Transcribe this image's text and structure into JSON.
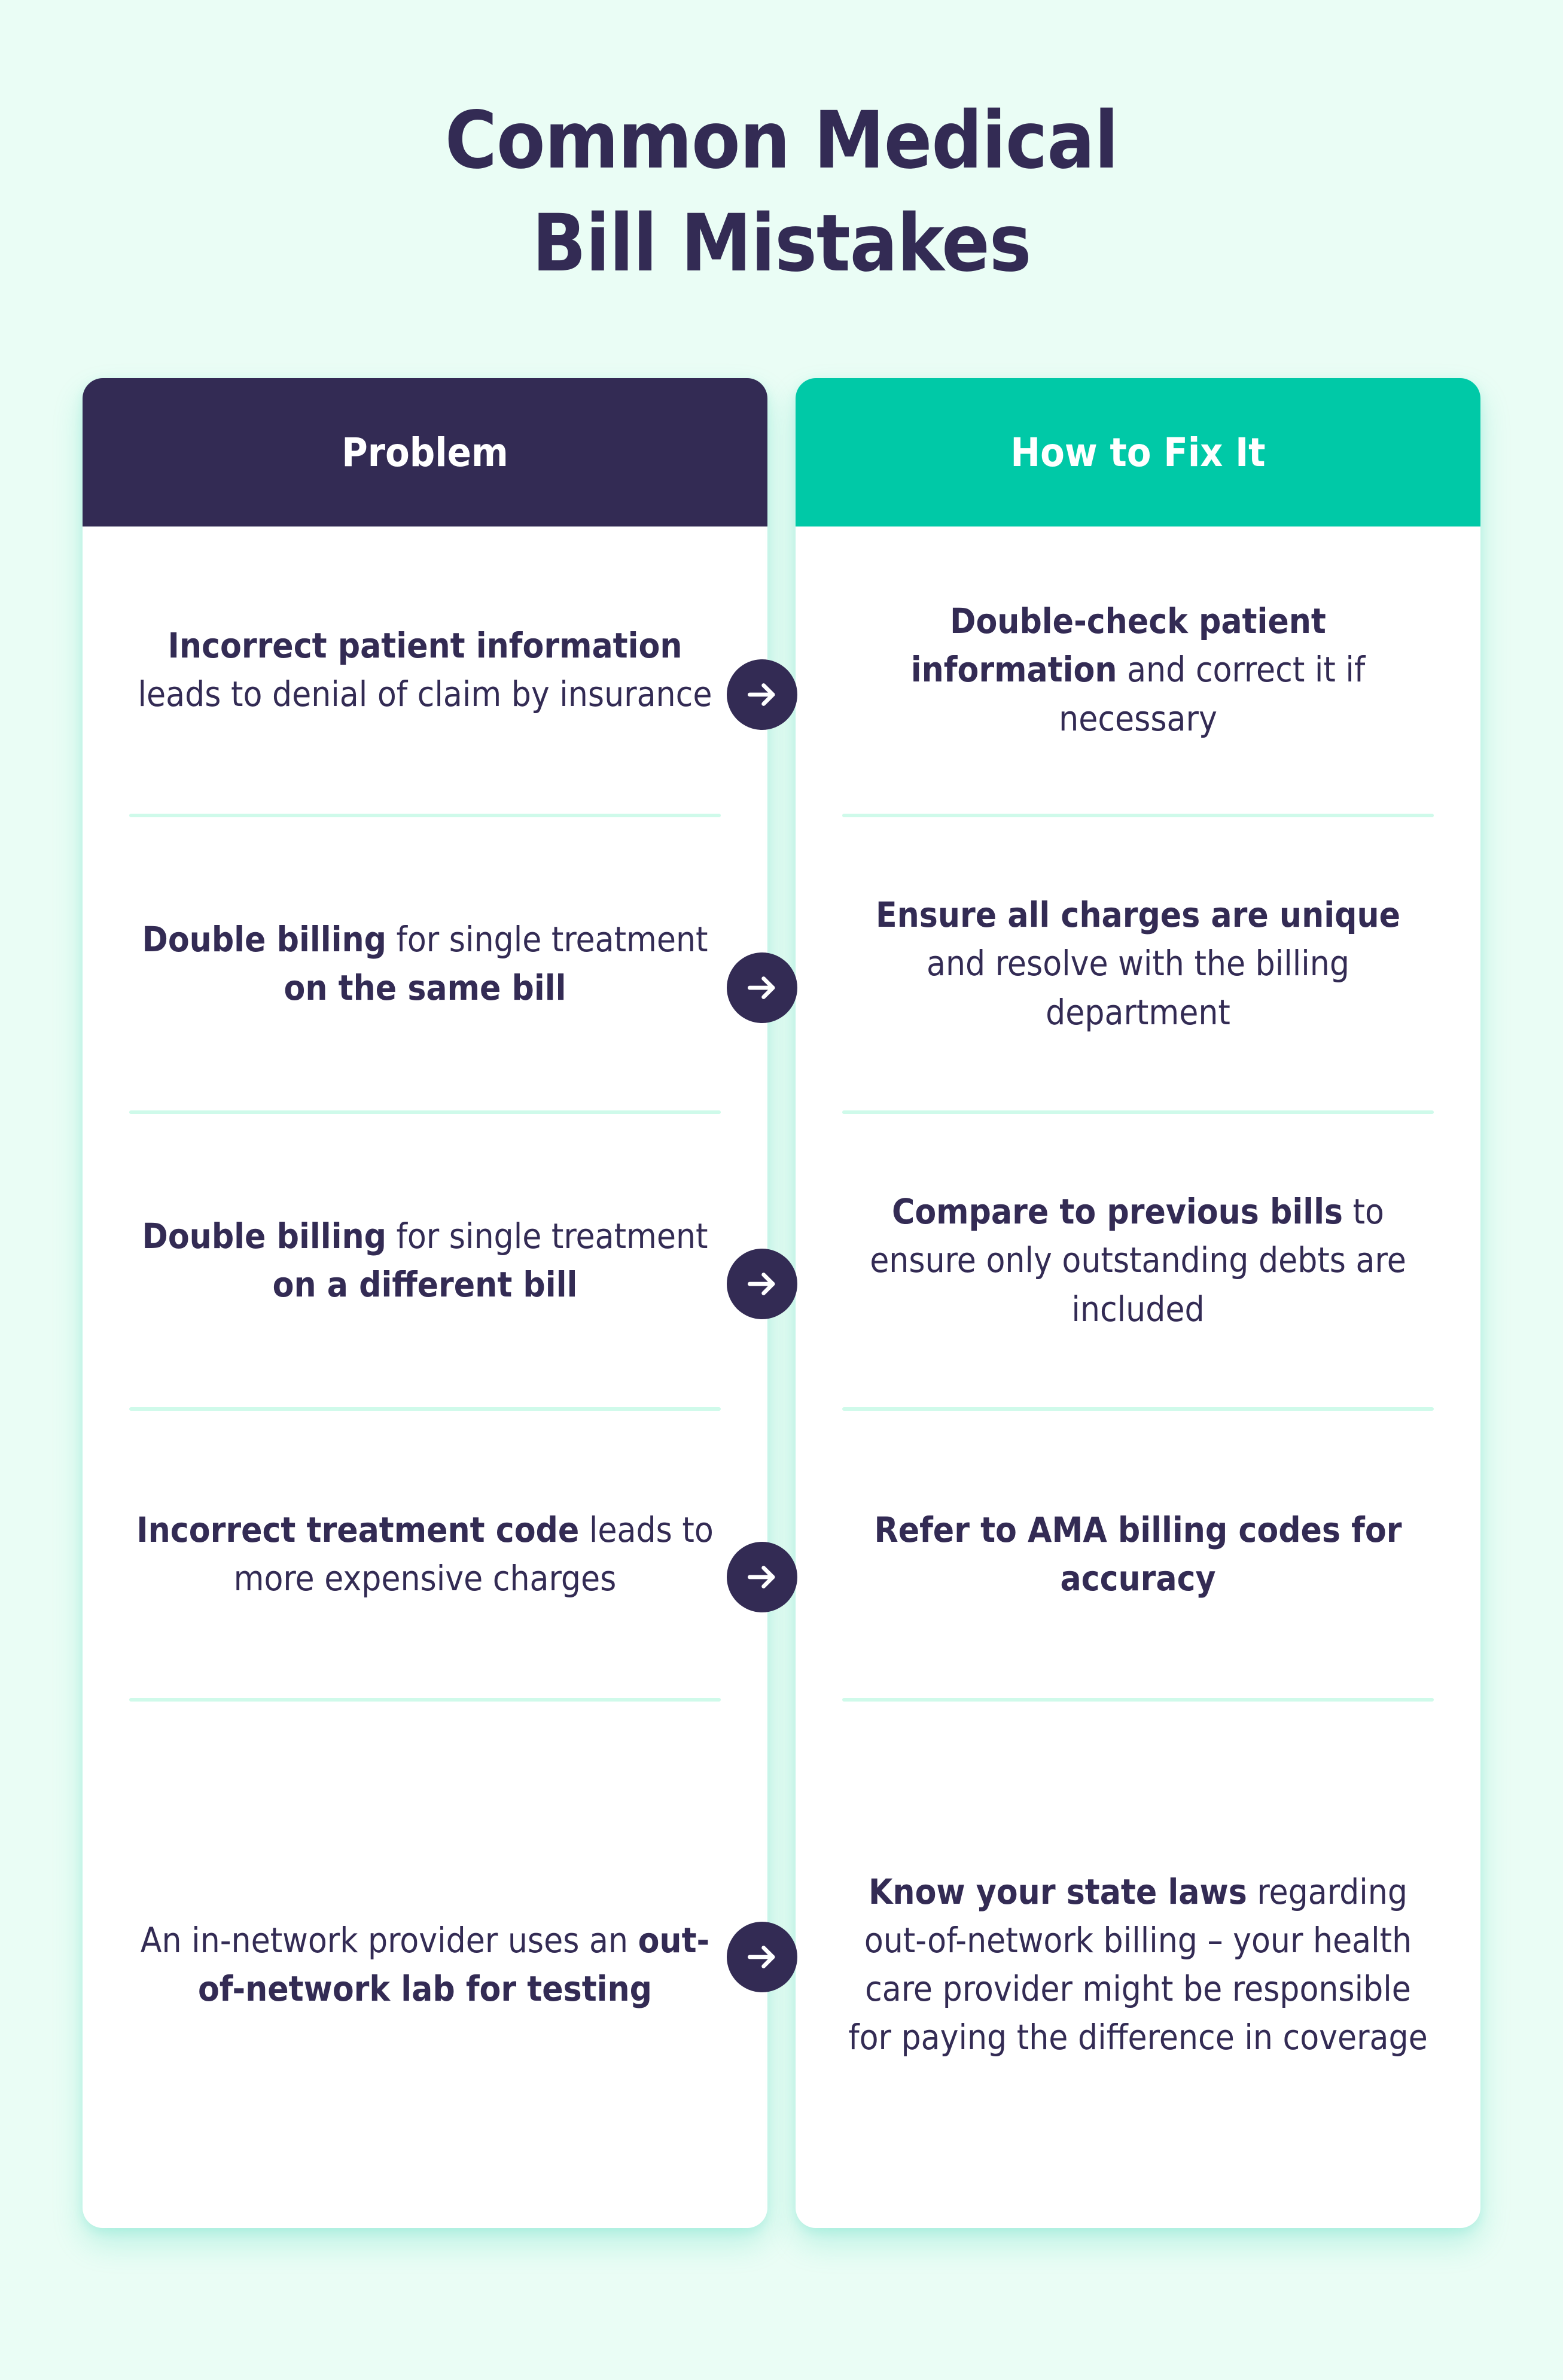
{
  "theme": {
    "background": "#EAFDF5",
    "card_background": "#FFFFFF",
    "dark_purple": "#332B54",
    "accent_green": "#00C9A7",
    "divider": "#CFFAEA"
  },
  "title": {
    "line1": "Common Medical",
    "line2": "Bill Mistakes"
  },
  "columns": {
    "problem_header": "Problem",
    "fix_header": "How to Fix It"
  },
  "arrow_icon": "arrow-right-icon",
  "rows": [
    {
      "problem_html": "<b>Incorrect patient information</b> leads to denial of claim by insurance",
      "problem_text": "Incorrect patient information leads to denial of claim by insurance",
      "fix_html": "<b>Double-check patient information</b> and correct it if necessary",
      "fix_text": "Double-check patient information and correct it if necessary"
    },
    {
      "problem_html": "<b>Double billing</b> for single treatment <b>on the same bill</b>",
      "problem_text": "Double billing for single treatment on the same bill",
      "fix_html": "<b>Ensure all charges are unique</b> and resolve with the billing department",
      "fix_text": "Ensure all charges are unique and resolve with the billing department"
    },
    {
      "problem_html": "<b>Double billing</b> for single treatment <b>on a different bill</b>",
      "problem_text": "Double billing for single treatment on a different bill",
      "fix_html": "<b>Compare to previous bills</b> to ensure only outstanding debts are included",
      "fix_text": "Compare to previous bills to ensure only outstanding debts are included"
    },
    {
      "problem_html": "<b>Incorrect treatment code</b> leads to more expensive charges",
      "problem_text": "Incorrect treatment code leads to more expensive charges",
      "fix_html": "<b>Refer to AMA billing codes for accuracy</b>",
      "fix_text": "Refer to AMA billing codes for accuracy"
    },
    {
      "problem_html": "An in-network provider uses an <b>out-of-network lab for testing</b>",
      "problem_text": "An in-network provider uses an out-of-network lab for testing",
      "fix_html": "<b>Know your state laws</b> regarding out-of-network billing – your health care provider might be responsible for paying the difference in coverage",
      "fix_text": "Know your state laws regarding out-of-network billing – your health care provider might be responsible for paying the difference in coverage"
    }
  ]
}
